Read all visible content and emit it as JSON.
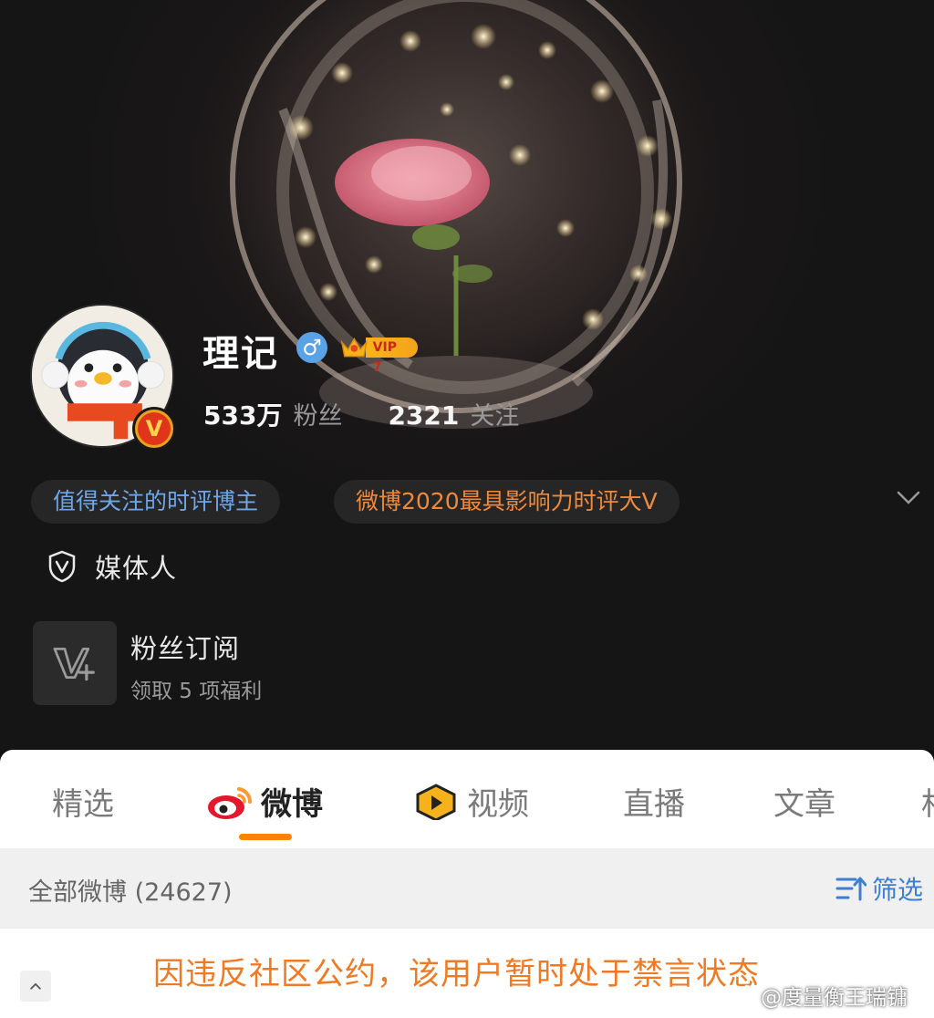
{
  "profile": {
    "username": "理记",
    "gender_symbol": "♂",
    "vip_label": "VIP 7",
    "verified_badge": "V",
    "followers_count": "533万",
    "followers_label": "粉丝",
    "following_count": "2321",
    "following_label": "关注"
  },
  "tags": {
    "tag1": "值得关注的时评博主",
    "tag2": "微博2020最具影响力时评大V"
  },
  "media_label": "媒体人",
  "fan_subscription": {
    "title": "粉丝订阅",
    "subtitle": "领取 5 项福利"
  },
  "tabs": [
    {
      "label": "精选"
    },
    {
      "label": "微博"
    },
    {
      "label": "视频"
    },
    {
      "label": "直播"
    },
    {
      "label": "文章"
    },
    {
      "label": "相"
    }
  ],
  "feed": {
    "all_label": "全部微博 (24627)",
    "filter_label": "筛选",
    "notice": "因违反社区公约，该用户暂时处于禁言状态"
  },
  "watermark": "@度量衡王瑞镛",
  "colors": {
    "accent": "#ff8200",
    "tag_blue": "#6fa6e8",
    "tag_orange": "#f0893b",
    "notice": "#f07a24",
    "filter_blue": "#3d7fd1"
  },
  "icons": [
    "shield-v-icon",
    "v-plus-icon",
    "weibo-logo-icon",
    "video-play-icon",
    "filter-icon",
    "chevron-down-icon",
    "chevron-up-icon",
    "crown-icon"
  ]
}
